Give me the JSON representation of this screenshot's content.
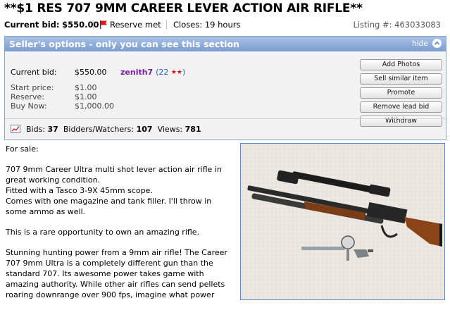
{
  "listing": {
    "title": "**$1 RES 707 9MM CAREER LEVER ACTION AIR RIFLE**",
    "current_bid_label": "Current bid:",
    "current_bid_value": "$550.00",
    "reserve_status": "Reserve met",
    "closes": "Closes: 19 hours",
    "listing_number": "Listing #: 463033083"
  },
  "seller_panel": {
    "heading": "Seller's options - only you can see this section",
    "hide_label": "hide",
    "rows": [
      {
        "label": "Current bid:",
        "value": "$550.00"
      },
      {
        "label": "Start price:",
        "value": "$1.00"
      },
      {
        "label": "Reserve:",
        "value": "$1.00"
      },
      {
        "label": "Buy Now:",
        "value": "$1,000.00"
      }
    ],
    "seller_name": "zenith7",
    "seller_rating": "22",
    "seller_stars": "★★",
    "buttons": [
      "Add Photos",
      "Sell similar item",
      "Promote",
      "Remove lead bid",
      "Withdraw"
    ],
    "stats": {
      "bids_label": "Bids:",
      "bids": "37",
      "watchers_label": "Bidders/Watchers:",
      "watchers": "107",
      "views_label": "Views:",
      "views": "781"
    }
  },
  "description": {
    "p1": "For sale:",
    "p2_l1": "707 9mm Career Ultra multi shot lever action air rifle in",
    "p2_l2": "great working condition.",
    "p2_l3": "Fitted with a Tasco 3-9X 45mm scope.",
    "p2_l4": "Comes with one magazine and tank filler. I'll throw in",
    "p2_l5": "some ammo as well.",
    "p3": "This is a rare opportunity to own an amazing rifle.",
    "p4_l1": "Stunning hunting power from a 9mm air rifle! The Career",
    "p4_l2": "707 9mm Ultra is a completely different gun than the",
    "p4_l3": "standard 707. Its awesome power takes game with",
    "p4_l4": "amazing authority. While other air rifles can send pellets",
    "p4_l5": "roaring downrange over 900 fps, imagine what power"
  },
  "colors": {
    "panel_header": "#7d9dd0",
    "seller_name": "#7a1da0",
    "rating_number": "#2860c0",
    "star_red": "#d01010",
    "photo_border": "#5a8ad0"
  },
  "icons": {
    "reserve": "red-flag-icon",
    "hide": "chevron-up-icon",
    "stats": "chart-icon"
  }
}
